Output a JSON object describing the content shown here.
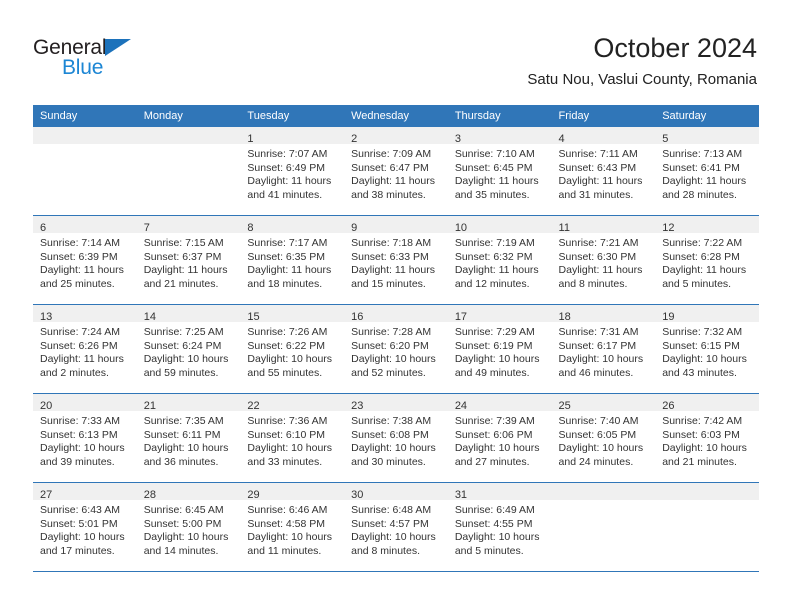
{
  "brand": {
    "name_top": "General",
    "name_bottom": "Blue",
    "accent_color": "#1c86d4",
    "triangle_color": "#1c72bb"
  },
  "header": {
    "title": "October 2024",
    "subtitle": "Satu Nou, Vaslui County, Romania"
  },
  "theme": {
    "header_row_bg": "#3076b8",
    "header_row_text": "#ffffff",
    "daynum_band_bg": "#f0f0f0",
    "grid_line": "#3076b8",
    "body_text": "#333333"
  },
  "weekday_headers": [
    "Sunday",
    "Monday",
    "Tuesday",
    "Wednesday",
    "Thursday",
    "Friday",
    "Saturday"
  ],
  "weeks": [
    [
      {
        "day": "",
        "lines": []
      },
      {
        "day": "",
        "lines": []
      },
      {
        "day": "1",
        "lines": [
          "Sunrise: 7:07 AM",
          "Sunset: 6:49 PM",
          "Daylight: 11 hours",
          "and 41 minutes."
        ]
      },
      {
        "day": "2",
        "lines": [
          "Sunrise: 7:09 AM",
          "Sunset: 6:47 PM",
          "Daylight: 11 hours",
          "and 38 minutes."
        ]
      },
      {
        "day": "3",
        "lines": [
          "Sunrise: 7:10 AM",
          "Sunset: 6:45 PM",
          "Daylight: 11 hours",
          "and 35 minutes."
        ]
      },
      {
        "day": "4",
        "lines": [
          "Sunrise: 7:11 AM",
          "Sunset: 6:43 PM",
          "Daylight: 11 hours",
          "and 31 minutes."
        ]
      },
      {
        "day": "5",
        "lines": [
          "Sunrise: 7:13 AM",
          "Sunset: 6:41 PM",
          "Daylight: 11 hours",
          "and 28 minutes."
        ]
      }
    ],
    [
      {
        "day": "6",
        "lines": [
          "Sunrise: 7:14 AM",
          "Sunset: 6:39 PM",
          "Daylight: 11 hours",
          "and 25 minutes."
        ]
      },
      {
        "day": "7",
        "lines": [
          "Sunrise: 7:15 AM",
          "Sunset: 6:37 PM",
          "Daylight: 11 hours",
          "and 21 minutes."
        ]
      },
      {
        "day": "8",
        "lines": [
          "Sunrise: 7:17 AM",
          "Sunset: 6:35 PM",
          "Daylight: 11 hours",
          "and 18 minutes."
        ]
      },
      {
        "day": "9",
        "lines": [
          "Sunrise: 7:18 AM",
          "Sunset: 6:33 PM",
          "Daylight: 11 hours",
          "and 15 minutes."
        ]
      },
      {
        "day": "10",
        "lines": [
          "Sunrise: 7:19 AM",
          "Sunset: 6:32 PM",
          "Daylight: 11 hours",
          "and 12 minutes."
        ]
      },
      {
        "day": "11",
        "lines": [
          "Sunrise: 7:21 AM",
          "Sunset: 6:30 PM",
          "Daylight: 11 hours",
          "and 8 minutes."
        ]
      },
      {
        "day": "12",
        "lines": [
          "Sunrise: 7:22 AM",
          "Sunset: 6:28 PM",
          "Daylight: 11 hours",
          "and 5 minutes."
        ]
      }
    ],
    [
      {
        "day": "13",
        "lines": [
          "Sunrise: 7:24 AM",
          "Sunset: 6:26 PM",
          "Daylight: 11 hours",
          "and 2 minutes."
        ]
      },
      {
        "day": "14",
        "lines": [
          "Sunrise: 7:25 AM",
          "Sunset: 6:24 PM",
          "Daylight: 10 hours",
          "and 59 minutes."
        ]
      },
      {
        "day": "15",
        "lines": [
          "Sunrise: 7:26 AM",
          "Sunset: 6:22 PM",
          "Daylight: 10 hours",
          "and 55 minutes."
        ]
      },
      {
        "day": "16",
        "lines": [
          "Sunrise: 7:28 AM",
          "Sunset: 6:20 PM",
          "Daylight: 10 hours",
          "and 52 minutes."
        ]
      },
      {
        "day": "17",
        "lines": [
          "Sunrise: 7:29 AM",
          "Sunset: 6:19 PM",
          "Daylight: 10 hours",
          "and 49 minutes."
        ]
      },
      {
        "day": "18",
        "lines": [
          "Sunrise: 7:31 AM",
          "Sunset: 6:17 PM",
          "Daylight: 10 hours",
          "and 46 minutes."
        ]
      },
      {
        "day": "19",
        "lines": [
          "Sunrise: 7:32 AM",
          "Sunset: 6:15 PM",
          "Daylight: 10 hours",
          "and 43 minutes."
        ]
      }
    ],
    [
      {
        "day": "20",
        "lines": [
          "Sunrise: 7:33 AM",
          "Sunset: 6:13 PM",
          "Daylight: 10 hours",
          "and 39 minutes."
        ]
      },
      {
        "day": "21",
        "lines": [
          "Sunrise: 7:35 AM",
          "Sunset: 6:11 PM",
          "Daylight: 10 hours",
          "and 36 minutes."
        ]
      },
      {
        "day": "22",
        "lines": [
          "Sunrise: 7:36 AM",
          "Sunset: 6:10 PM",
          "Daylight: 10 hours",
          "and 33 minutes."
        ]
      },
      {
        "day": "23",
        "lines": [
          "Sunrise: 7:38 AM",
          "Sunset: 6:08 PM",
          "Daylight: 10 hours",
          "and 30 minutes."
        ]
      },
      {
        "day": "24",
        "lines": [
          "Sunrise: 7:39 AM",
          "Sunset: 6:06 PM",
          "Daylight: 10 hours",
          "and 27 minutes."
        ]
      },
      {
        "day": "25",
        "lines": [
          "Sunrise: 7:40 AM",
          "Sunset: 6:05 PM",
          "Daylight: 10 hours",
          "and 24 minutes."
        ]
      },
      {
        "day": "26",
        "lines": [
          "Sunrise: 7:42 AM",
          "Sunset: 6:03 PM",
          "Daylight: 10 hours",
          "and 21 minutes."
        ]
      }
    ],
    [
      {
        "day": "27",
        "lines": [
          "Sunrise: 6:43 AM",
          "Sunset: 5:01 PM",
          "Daylight: 10 hours",
          "and 17 minutes."
        ]
      },
      {
        "day": "28",
        "lines": [
          "Sunrise: 6:45 AM",
          "Sunset: 5:00 PM",
          "Daylight: 10 hours",
          "and 14 minutes."
        ]
      },
      {
        "day": "29",
        "lines": [
          "Sunrise: 6:46 AM",
          "Sunset: 4:58 PM",
          "Daylight: 10 hours",
          "and 11 minutes."
        ]
      },
      {
        "day": "30",
        "lines": [
          "Sunrise: 6:48 AM",
          "Sunset: 4:57 PM",
          "Daylight: 10 hours",
          "and 8 minutes."
        ]
      },
      {
        "day": "31",
        "lines": [
          "Sunrise: 6:49 AM",
          "Sunset: 4:55 PM",
          "Daylight: 10 hours",
          "and 5 minutes."
        ]
      },
      {
        "day": "",
        "lines": []
      },
      {
        "day": "",
        "lines": []
      }
    ]
  ]
}
